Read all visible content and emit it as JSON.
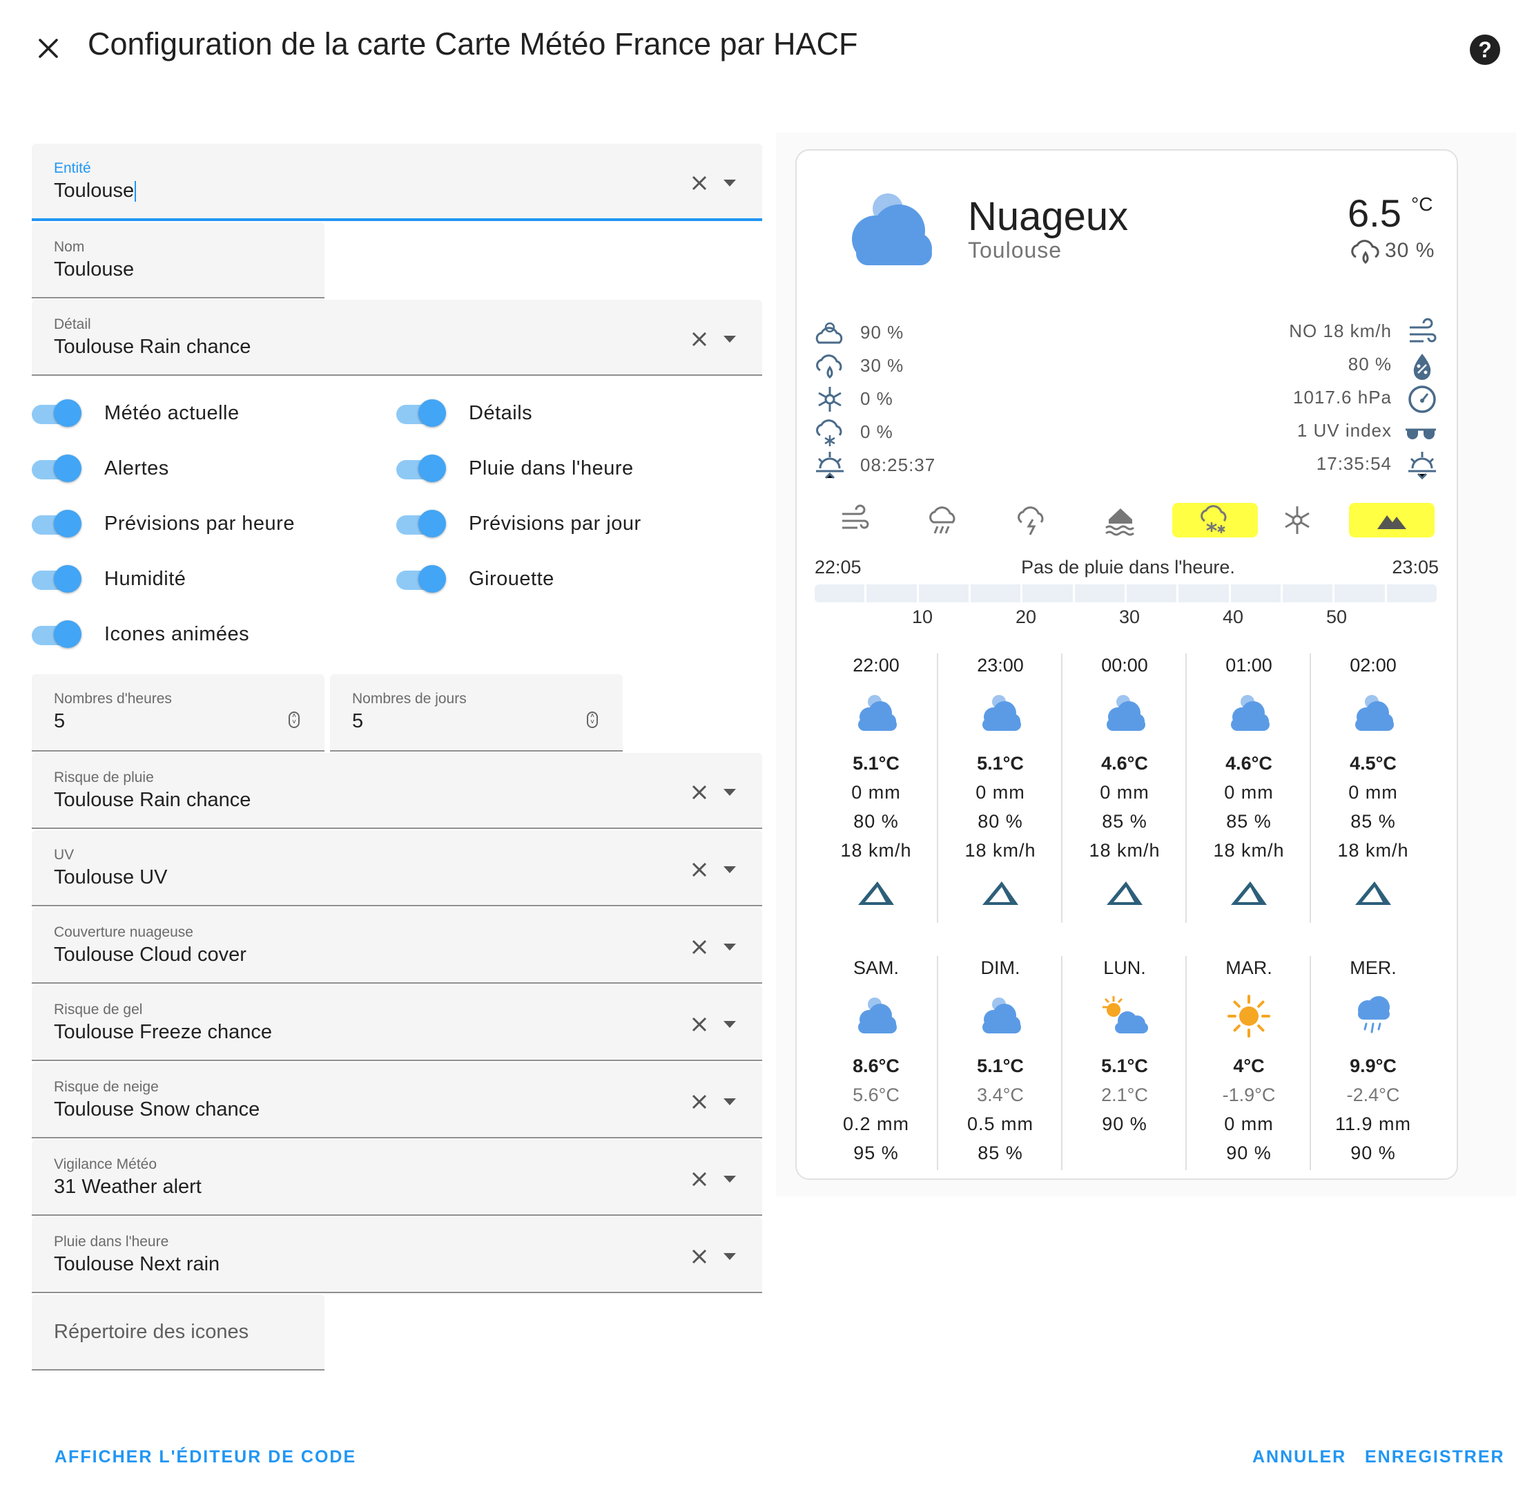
{
  "dialog": {
    "title": "Configuration de la carte Carte Météo France par HACF",
    "help_glyph": "?",
    "close_icon": "close-icon",
    "help_icon": "help-circle-icon"
  },
  "form": {
    "entity": {
      "label": "Entité",
      "value": "Toulouse"
    },
    "name": {
      "label": "Nom",
      "value": "Toulouse"
    },
    "detail": {
      "label": "Détail",
      "value": "Toulouse Rain chance"
    },
    "toggles": [
      {
        "label": "Météo actuelle",
        "on": true
      },
      {
        "label": "Détails",
        "on": true
      },
      {
        "label": "Alertes",
        "on": true
      },
      {
        "label": "Pluie dans l'heure",
        "on": true
      },
      {
        "label": "Prévisions par heure",
        "on": true
      },
      {
        "label": "Prévisions par jour",
        "on": true
      },
      {
        "label": "Humidité",
        "on": true
      },
      {
        "label": "Girouette",
        "on": true
      },
      {
        "label": "Icones animées",
        "on": true
      }
    ],
    "hours": {
      "label": "Nombres d'heures",
      "value": "5"
    },
    "days": {
      "label": "Nombres de jours",
      "value": "5"
    },
    "rain_risk": {
      "label": "Risque de pluie",
      "value": "Toulouse Rain chance"
    },
    "uv": {
      "label": "UV",
      "value": "Toulouse UV"
    },
    "cloud": {
      "label": "Couverture nuageuse",
      "value": "Toulouse Cloud cover"
    },
    "freeze": {
      "label": "Risque de gel",
      "value": "Toulouse Freeze chance"
    },
    "snow": {
      "label": "Risque de neige",
      "value": "Toulouse Snow chance"
    },
    "vigilance": {
      "label": "Vigilance Météo",
      "value": "31 Weather alert"
    },
    "next_rain": {
      "label": "Pluie dans l'heure",
      "value": "Toulouse Next rain"
    },
    "icons_dir": {
      "placeholder": "Répertoire des icones"
    }
  },
  "footer": {
    "code_editor": "AFFICHER L'ÉDITEUR DE CODE",
    "cancel": "ANNULER",
    "save": "ENREGISTRER"
  },
  "preview": {
    "condition": "Nuageux",
    "city": "Toulouse",
    "temperature": "6.5",
    "unit": "°C",
    "rain_chance": "30 %",
    "attributes_left": [
      {
        "icon": "cloud-cover-icon",
        "value": "90 %"
      },
      {
        "icon": "rain-chance-icon",
        "value": "30 %"
      },
      {
        "icon": "freeze-icon",
        "value": "0 %"
      },
      {
        "icon": "snow-chance-icon",
        "value": "0 %"
      },
      {
        "icon": "sunrise-icon",
        "value": "08:25:37"
      }
    ],
    "attributes_right": [
      {
        "icon": "wind-icon",
        "value": "NO 18 km/h"
      },
      {
        "icon": "humidity-icon",
        "value": "80 %"
      },
      {
        "icon": "gauge-icon",
        "value": "1017.6 hPa"
      },
      {
        "icon": "sunglasses-icon",
        "value": "1 UV index"
      },
      {
        "icon": "sunset-icon",
        "value": "17:35:54"
      }
    ],
    "alerts": [
      {
        "icon": "wind-alert-icon",
        "active": false
      },
      {
        "icon": "rain-flood-alert-icon",
        "active": false
      },
      {
        "icon": "thunderstorm-alert-icon",
        "active": false
      },
      {
        "icon": "flood-alert-icon",
        "active": false
      },
      {
        "icon": "snow-ice-alert-icon",
        "active": true,
        "color": "#ffff44"
      },
      {
        "icon": "extreme-cold-alert-icon",
        "active": false
      },
      {
        "icon": "avalanche-alert-icon",
        "active": true,
        "color": "#ffff44"
      }
    ],
    "rain": {
      "start": "22:05",
      "message": "Pas de pluie dans l'heure.",
      "end": "23:05",
      "ticks": [
        "10",
        "20",
        "30",
        "40",
        "50"
      ]
    },
    "hourly": [
      {
        "time": "22:00",
        "icon": "cloudy-icon",
        "temp": "5.1°C",
        "precip": "0 mm",
        "humidity": "80 %",
        "wind": "18 km/h"
      },
      {
        "time": "23:00",
        "icon": "cloudy-icon",
        "temp": "5.1°C",
        "precip": "0 mm",
        "humidity": "80 %",
        "wind": "18 km/h"
      },
      {
        "time": "00:00",
        "icon": "cloudy-icon",
        "temp": "4.6°C",
        "precip": "0 mm",
        "humidity": "85 %",
        "wind": "18 km/h"
      },
      {
        "time": "01:00",
        "icon": "cloudy-icon",
        "temp": "4.6°C",
        "precip": "0 mm",
        "humidity": "85 %",
        "wind": "18 km/h"
      },
      {
        "time": "02:00",
        "icon": "cloudy-icon",
        "temp": "4.5°C",
        "precip": "0 mm",
        "humidity": "85 %",
        "wind": "18 km/h"
      }
    ],
    "daily": [
      {
        "day": "SAM.",
        "icon": "cloudy-icon",
        "high": "8.6°C",
        "low": "5.6°C",
        "precip": "0.2 mm",
        "humidity": "95 %"
      },
      {
        "day": "DIM.",
        "icon": "cloudy-icon",
        "high": "5.1°C",
        "low": "3.4°C",
        "precip": "0.5 mm",
        "humidity": "85 %"
      },
      {
        "day": "LUN.",
        "icon": "partly-cloudy-icon",
        "high": "5.1°C",
        "low": "2.1°C",
        "precip": "90 %",
        "humidity": ""
      },
      {
        "day": "MAR.",
        "icon": "sunny-icon",
        "high": "4°C",
        "low": "-1.9°C",
        "precip": "0 mm",
        "humidity": "90 %"
      },
      {
        "day": "MER.",
        "icon": "rainy-icon",
        "high": "9.9°C",
        "low": "-2.4°C",
        "precip": "11.9 mm",
        "humidity": "90 %"
      }
    ],
    "colors": {
      "accent": "#2196f3",
      "icon_blue": "#5b9be6",
      "alert_yellow": "#ffff44",
      "wind_arrow": "#2d5f7a"
    }
  }
}
